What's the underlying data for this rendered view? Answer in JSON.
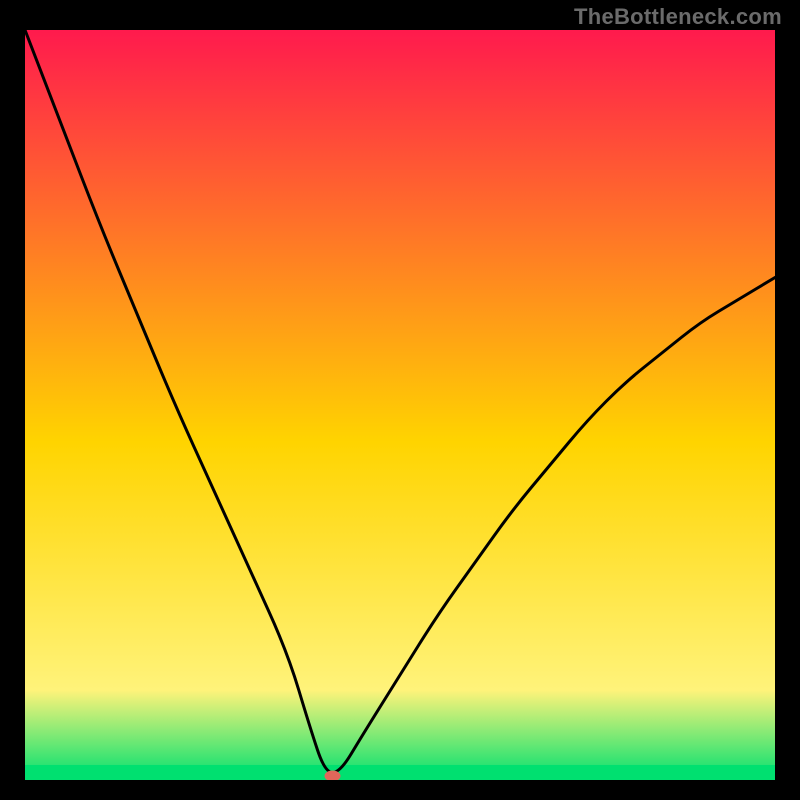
{
  "watermark": "TheBottleneck.com",
  "chart_data": {
    "type": "line",
    "title": "",
    "xlabel": "",
    "ylabel": "",
    "xlim": [
      0,
      100
    ],
    "ylim": [
      0,
      100
    ],
    "categories": [
      0,
      5,
      10,
      15,
      20,
      25,
      30,
      35,
      38,
      40,
      42,
      45,
      50,
      55,
      60,
      65,
      70,
      75,
      80,
      85,
      90,
      95,
      100
    ],
    "values": [
      100,
      87,
      74,
      62,
      50,
      39,
      28,
      17,
      7,
      1,
      1,
      6,
      14,
      22,
      29,
      36,
      42,
      48,
      53,
      57,
      61,
      64,
      67
    ],
    "background_gradient": {
      "top": "#ff1a4d",
      "mid": "#ffd400",
      "bottom": "#00e070"
    },
    "marker": {
      "x": 41,
      "y": 0,
      "color": "#e0675a"
    },
    "floor_band_pct": 2
  }
}
